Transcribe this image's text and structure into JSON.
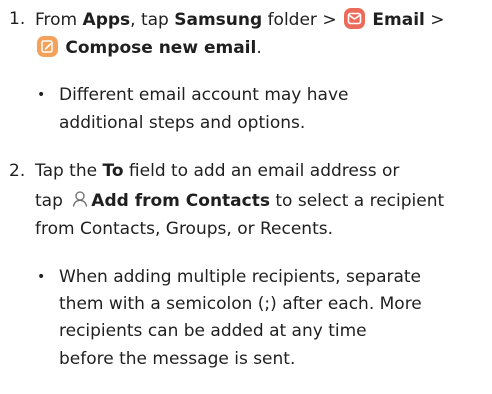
{
  "step1": {
    "number": "1.",
    "t1": "From ",
    "b1": "Apps",
    "t2": ", tap ",
    "b2": "Samsung",
    "t3": " folder > ",
    "email_icon": "email-app-icon",
    "b3": "Email",
    "t4": " >",
    "compose_icon": "compose-email-icon",
    "b4": "Compose new email",
    "t5": ".",
    "bullet": {
      "line1": "Different email account may have",
      "line2": "additional steps and options."
    }
  },
  "step2": {
    "number": "2.",
    "l1_t1": "Tap the ",
    "l1_b1": "To",
    "l1_t2": " field to add an email address or",
    "l2_t1": "tap ",
    "contacts_icon": "add-contact-icon",
    "l2_b1": "Add from Contacts",
    "l2_t2": " to select a recipient",
    "l3": "from Contacts, Groups, or Recents.",
    "bullet": {
      "line1": "When adding multiple recipients, separate",
      "line2": "them with a semicolon (;) after each. More",
      "line3": "recipients can be added at any time",
      "line4": "before the message is sent."
    }
  },
  "colors": {
    "text": "#1f1f1f",
    "email_icon": "#ec6a5a",
    "compose_icon": "#f4a15b"
  }
}
